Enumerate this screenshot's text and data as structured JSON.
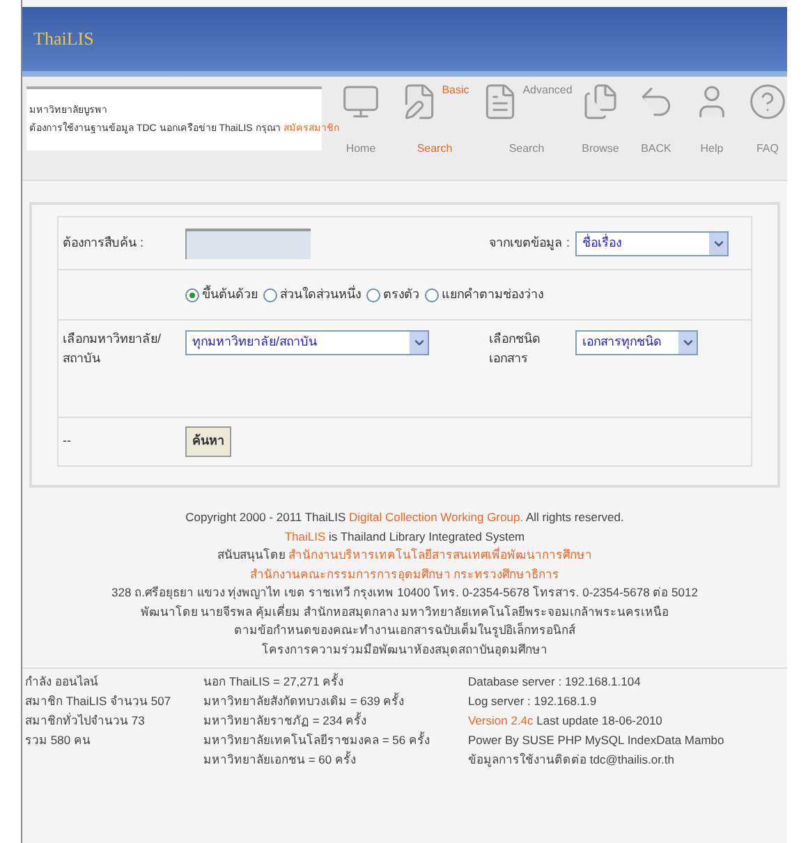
{
  "header": {
    "logo": "ThaiLIS"
  },
  "notice": {
    "institution": "มหาวิทยาลัยบูรพา",
    "message": "ต้องการใช้งานฐานข้อมูล TDC นอกเครือข่าย ThaiLIS กรุณา",
    "link": "สมัครสมาชิก"
  },
  "nav": [
    {
      "kind": "home",
      "label": "Home",
      "selected": false
    },
    {
      "kind": "basic",
      "title": "Basic",
      "label": "Search",
      "selected": true
    },
    {
      "kind": "advanced",
      "title": "Advanced",
      "label": "Search",
      "selected": false
    },
    {
      "kind": "browse",
      "label": "Browse",
      "selected": false
    },
    {
      "kind": "back",
      "label": "BACK",
      "selected": false
    },
    {
      "kind": "help",
      "label": "Help",
      "selected": false
    },
    {
      "kind": "faq",
      "label": "FAQ",
      "selected": false
    }
  ],
  "form": {
    "query_label": "ต้องการสืบค้น :",
    "field_label": "จากเขตข้อมูล :",
    "field_value": "ชื่อเรื่อง",
    "match_options": [
      {
        "label": "ขึ้นต้นด้วย",
        "selected": true
      },
      {
        "label": "ส่วนใดส่วนหนึ่ง",
        "selected": false
      },
      {
        "label": "ตรงตัว",
        "selected": false
      },
      {
        "label": "แยกคำตามช่องว่าง",
        "selected": false
      }
    ],
    "university_label": "เลือกมหาวิทยาลัย/สถาบัน",
    "university_value": "ทุกมหาวิทยาลัย/สถาบัน",
    "doctype_label": "เลือกชนิดเอกสาร",
    "doctype_value": "เอกสารทุกชนิด",
    "footer_mark": "--",
    "search_button": "ค้นหา"
  },
  "credits": [
    [
      {
        "text": "Copyright 2000 - 2011 ThaiLIS ",
        "highlight": false
      },
      {
        "text": "Digital Collection Working Group.",
        "highlight": true
      },
      {
        "text": " All rights reserved.",
        "highlight": false
      }
    ],
    [
      {
        "text": "ThaiLIS",
        "highlight": true
      },
      {
        "text": " is Thailand Library Integrated System",
        "highlight": false
      }
    ],
    [
      {
        "text": "สนับสนุนโดย ",
        "highlight": false
      },
      {
        "text": "สำนักงานบริหารเทคโนโลยีสารสนเทศเพื่อพัฒนาการศึกษา",
        "highlight": true
      }
    ],
    [
      {
        "text": "สำนักงานคณะกรรมการการอุดมศึกษา กระทรวงศึกษาธิการ",
        "highlight": true
      }
    ],
    [
      {
        "text": "328 ถ.ศรีอยุธยา แขวง ทุ่งพญาไท เขต ราชเทวี กรุงเทพ 10400 โทร. 0-2354-5678 โทรสาร. 0-2354-5678 ต่อ 5012",
        "highlight": false
      }
    ],
    [
      {
        "text": "พัฒนาโดย นายจีรพล คุ้มเคี่ยม สำนักหอสมุดกลาง มหาวิทยาลัยเทคโนโลยีพระจอมเกล้าพระนครเหนือ",
        "highlight": false
      }
    ],
    [
      {
        "text": "ตามข้อกำหนดของคณะทำงานเอกสารฉบับเต็มในรูปอิเล็กทรอนิกส์",
        "highlight": false
      }
    ],
    [
      {
        "text": "โครงการความร่วมมือพัฒนาห้องสมุดสถาบันอุดมศึกษา",
        "highlight": false
      }
    ]
  ],
  "online": [
    "กำลัง ออนไลน์",
    "สมาชิก ThaiLIS จำนวน 507",
    "สมาชิกทั่วไปจำนวน 73",
    "รวม 580 คน"
  ],
  "usage": [
    "นอก ThaiLIS = 27,271 ครั้ง",
    "มหาวิทยาลัยสังกัดทบวงเดิม = 639 ครั้ง",
    "มหาวิทยาลัยราชภัฏ = 234 ครั้ง",
    "มหาวิทยาลัยเทคโนโลยีราชมงคล = 56 ครั้ง",
    "มหาวิทยาลัยเอกชน = 60 ครั้ง"
  ],
  "server": [
    [
      {
        "text": "Database server : 192.168.1.104",
        "highlight": false
      }
    ],
    [
      {
        "text": "Log server : 192.168.1.9",
        "highlight": false
      }
    ],
    [
      {
        "text": "Version 2.4c",
        "highlight": true
      },
      {
        "text": " Last update 18-06-2010",
        "highlight": false
      }
    ],
    [
      {
        "text": "Power By SUSE PHP MySQL IndexData Mambo",
        "highlight": false
      }
    ],
    [
      {
        "text": "ข้อมูลการใช้งานติดต่อ tdc@thailis.or.th",
        "highlight": false
      }
    ]
  ]
}
